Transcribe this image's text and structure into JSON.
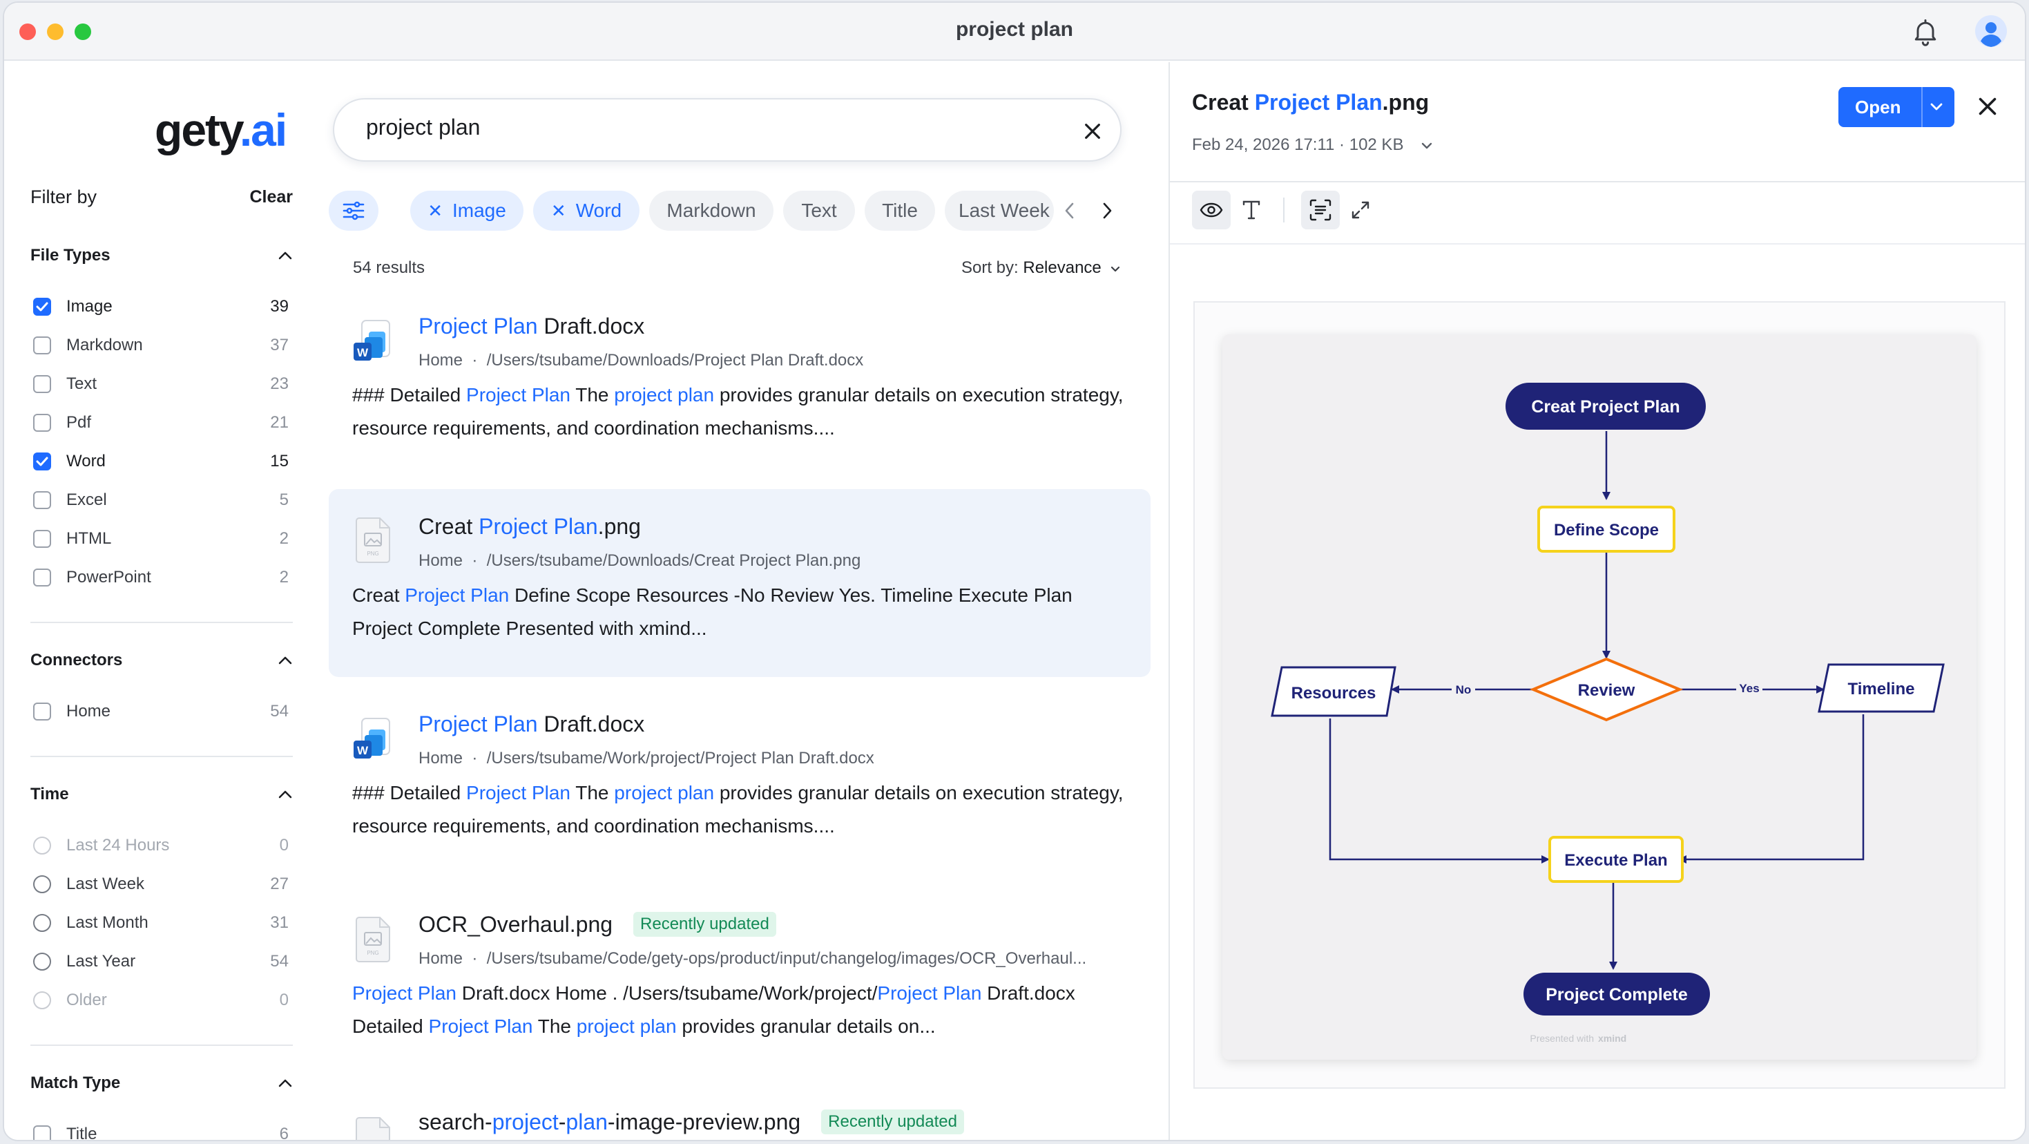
{
  "window": {
    "title": "project plan"
  },
  "logo": {
    "main": "gety",
    "dot": ".",
    "suffix": "ai"
  },
  "filter": {
    "title": "Filter by",
    "clear": "Clear"
  },
  "sections": {
    "file_types": {
      "title": "File Types",
      "items": [
        {
          "label": "Image",
          "count": "39",
          "checked": true
        },
        {
          "label": "Markdown",
          "count": "37",
          "checked": false
        },
        {
          "label": "Text",
          "count": "23",
          "checked": false
        },
        {
          "label": "Pdf",
          "count": "21",
          "checked": false
        },
        {
          "label": "Word",
          "count": "15",
          "checked": true
        },
        {
          "label": "Excel",
          "count": "5",
          "checked": false
        },
        {
          "label": "HTML",
          "count": "2",
          "checked": false
        },
        {
          "label": "PowerPoint",
          "count": "2",
          "checked": false
        }
      ]
    },
    "connectors": {
      "title": "Connectors",
      "items": [
        {
          "label": "Home",
          "count": "54",
          "checked": false
        }
      ]
    },
    "time": {
      "title": "Time",
      "items": [
        {
          "label": "Last 24 Hours",
          "count": "0"
        },
        {
          "label": "Last Week",
          "count": "27"
        },
        {
          "label": "Last Month",
          "count": "31"
        },
        {
          "label": "Last Year",
          "count": "54"
        },
        {
          "label": "Older",
          "count": "0"
        }
      ]
    },
    "match_type": {
      "title": "Match Type",
      "items": [
        {
          "label": "Title",
          "count": "6"
        }
      ]
    }
  },
  "search": {
    "value": "project plan"
  },
  "chips": [
    {
      "label": "Image",
      "active": true
    },
    {
      "label": "Word",
      "active": true
    },
    {
      "label": "Markdown",
      "active": false
    },
    {
      "label": "Text",
      "active": false
    },
    {
      "label": "Title",
      "active": false
    },
    {
      "label": "Last Week",
      "active": false
    }
  ],
  "results_summary": {
    "count": "54 results",
    "sort_label": "Sort by:",
    "sort_value": "Relevance"
  },
  "results": [
    {
      "title_pre": "",
      "title_hl": "Project Plan",
      "title_post": " Draft.docx",
      "location": "Home",
      "path": "/Users/tsubame/Downloads/Project Plan Draft.docx",
      "snippet_1": "### Detailed ",
      "snippet_hl1": "Project Plan",
      "snippet_2": " The ",
      "snippet_hl2": "project plan",
      "snippet_3": " provides granular details on execution strategy, resource requirements, and coordination mechanisms...."
    },
    {
      "title_pre": "Creat ",
      "title_hl": "Project Plan",
      "title_post": ".png",
      "location": "Home",
      "path": "/Users/tsubame/Downloads/Creat Project Plan.png",
      "snippet_1": "Creat ",
      "snippet_hl1": "Project Plan",
      "snippet_2": " Define Scope Resources -No Review Yes. Timeline Execute Plan Project Complete Presented with xmind..."
    },
    {
      "title_pre": "",
      "title_hl": "Project Plan",
      "title_post": " Draft.docx",
      "location": "Home",
      "path": "/Users/tsubame/Work/project/Project Plan Draft.docx",
      "snippet_1": "### Detailed ",
      "snippet_hl1": "Project Plan",
      "snippet_2": " The ",
      "snippet_hl2": "project plan",
      "snippet_3": " provides granular details on execution strategy, resource requirements, and coordination mechanisms...."
    },
    {
      "title": "OCR_Overhaul.png",
      "badge": "Recently updated",
      "location": "Home",
      "path": "/Users/tsubame/Code/gety-ops/product/input/changelog/images/OCR_Overhaul...",
      "snippet_hl1": "Project Plan",
      "snippet_2": " Draft.docx Home . /Users/tsubame/Work/project/",
      "snippet_hl2": "Project Plan",
      "snippet_3": " Draft.docx Detailed ",
      "snippet_hl3": "Project Plan",
      "snippet_4": " The ",
      "snippet_hl4": "project plan",
      "snippet_5": " provides granular details on..."
    },
    {
      "title_pre": "search-",
      "title_hl": "project",
      "title_mid": "-",
      "title_hl2": "plan",
      "title_post": "-image-preview.png",
      "badge": "Recently updated"
    }
  ],
  "preview": {
    "title_pre": "Creat ",
    "title_hl": "Project Plan",
    "title_post": ".png",
    "meta": "Feb 24, 2026 17:11 · 102 KB",
    "open_label": "Open",
    "flowchart": {
      "start": "Creat Project Plan",
      "scope": "Define Scope",
      "review": "Review",
      "resources": "Resources",
      "timeline": "Timeline",
      "no": "No",
      "yes": "Yes",
      "execute": "Execute Plan",
      "complete": "Project Complete",
      "footer_a": "Presented with",
      "footer_b": "xmind"
    }
  },
  "colors": {
    "accent": "#1f6bff",
    "navy": "#1f2377",
    "yellow": "#f5d21c",
    "orange": "#f36f0c",
    "badge_bg": "#dff5ea",
    "badge_fg": "#138a56"
  }
}
